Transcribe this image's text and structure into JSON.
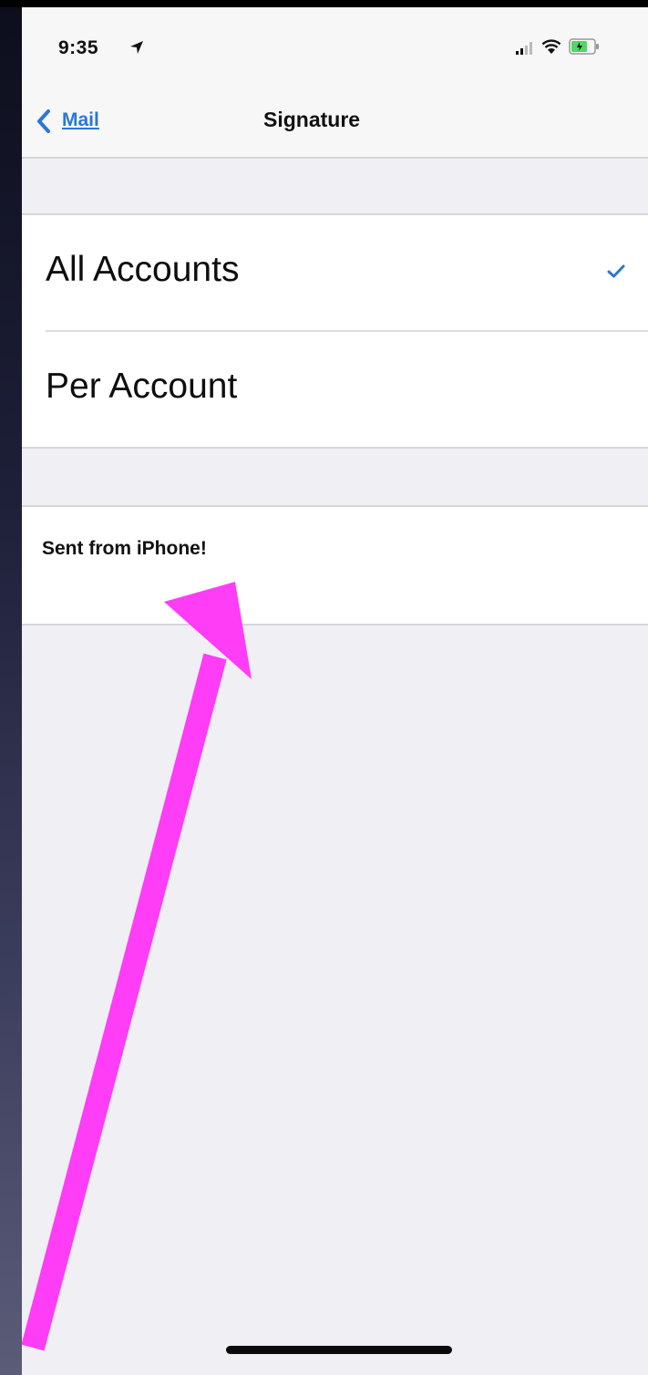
{
  "status_bar": {
    "time": "9:35",
    "icons": [
      "location-arrow-icon",
      "signal-icon",
      "wifi-icon",
      "battery-icon"
    ]
  },
  "nav": {
    "back_label": "Mail",
    "title": "Signature"
  },
  "options": [
    {
      "label": "All Accounts",
      "selected": true
    },
    {
      "label": "Per Account",
      "selected": false
    }
  ],
  "signature": {
    "text": "Sent from iPhone!"
  },
  "colors": {
    "accent": "#2a77d6",
    "background": "#efeff4",
    "annotation": "#ff3cf6",
    "battery": "#4cd964"
  }
}
